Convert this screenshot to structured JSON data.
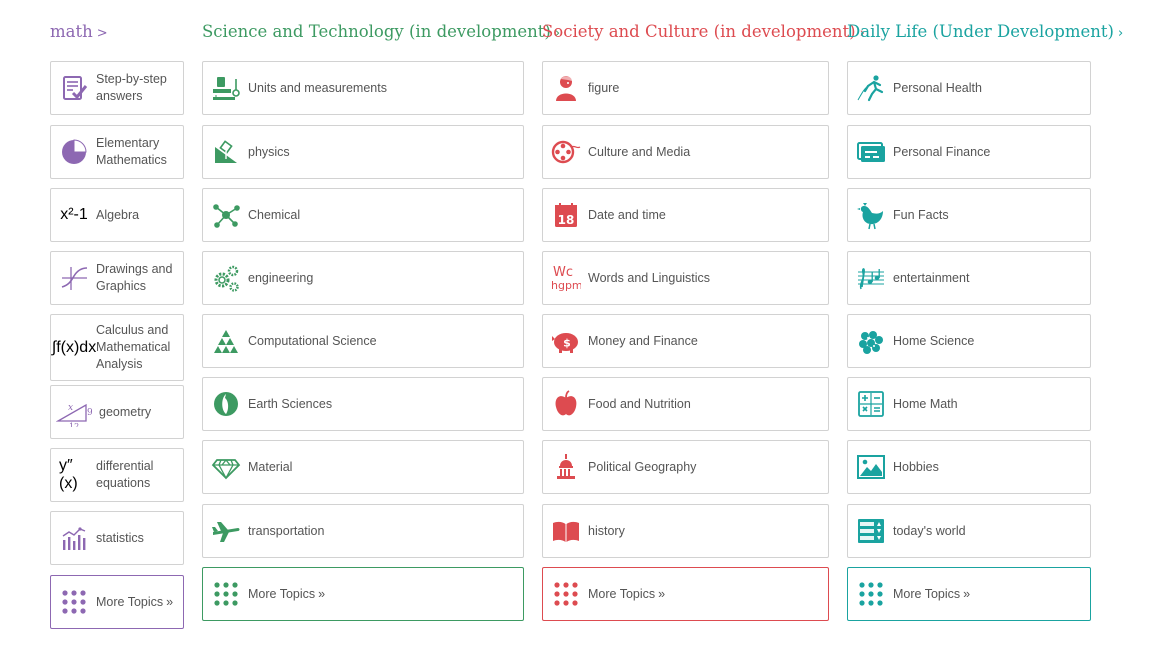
{
  "colors": {
    "math": "#8d68b2",
    "science": "#3d9a62",
    "society": "#dd4b50",
    "life": "#1aa3a0",
    "text": "#555555",
    "border": "#d2d2d2"
  },
  "columns": [
    {
      "key": "math",
      "title": "math",
      "chevron": ">",
      "items": [
        {
          "label": "Step-by-step answers",
          "icon": "checklist-icon"
        },
        {
          "label": "Elementary Mathematics",
          "icon": "fraction-pie-icon"
        },
        {
          "label": "Algebra",
          "icon": "algebra-icon",
          "glyph": "x²-1"
        },
        {
          "label": "Drawings and Graphics",
          "icon": "graph-plot-icon"
        },
        {
          "label": "Calculus and Mathematical Analysis",
          "icon": "integral-icon",
          "glyph": "∫f(x)dx"
        },
        {
          "label": "geometry",
          "icon": "triangle-geometry-icon",
          "glyph_top": "x",
          "glyph_side": "9",
          "glyph_bottom": "12"
        },
        {
          "label": "differential equations",
          "icon": "derivative-icon",
          "glyph": "y″(x)"
        },
        {
          "label": "statistics",
          "icon": "statistics-icon"
        }
      ],
      "more": {
        "label": "More Topics",
        "arrow": "»",
        "icon": "dots-grid-icon"
      }
    },
    {
      "key": "science",
      "title": "Science and Technology (in development)",
      "chevron": "›",
      "items": [
        {
          "label": "Units and measurements",
          "icon": "measurement-icon"
        },
        {
          "label": "physics",
          "icon": "physics-ramp-icon"
        },
        {
          "label": "Chemical",
          "icon": "molecule-icon"
        },
        {
          "label": "engineering",
          "icon": "gears-icon"
        },
        {
          "label": "Computational Science",
          "icon": "sierpinski-icon"
        },
        {
          "label": "Earth Sciences",
          "icon": "globe-icon"
        },
        {
          "label": "Material",
          "icon": "diamond-icon"
        },
        {
          "label": "transportation",
          "icon": "airplane-icon"
        }
      ],
      "more": {
        "label": "More Topics",
        "arrow": "»",
        "icon": "dots-grid-icon"
      }
    },
    {
      "key": "society",
      "title": "Society and Culture (in development)",
      "chevron": "›",
      "items": [
        {
          "label": "figure",
          "icon": "portrait-icon"
        },
        {
          "label": "Culture and Media",
          "icon": "film-reel-icon"
        },
        {
          "label": "Date and time",
          "icon": "calendar-icon",
          "glyph": "18"
        },
        {
          "label": "Words and Linguistics",
          "icon": "letters-icon",
          "glyph_top": "Wc",
          "glyph_bottom": "hgpm"
        },
        {
          "label": "Money and Finance",
          "icon": "piggy-bank-icon",
          "glyph": "$"
        },
        {
          "label": "Food and Nutrition",
          "icon": "apple-icon"
        },
        {
          "label": "Political Geography",
          "icon": "capitol-icon"
        },
        {
          "label": "history",
          "icon": "open-book-icon"
        }
      ],
      "more": {
        "label": "More Topics",
        "arrow": "»",
        "icon": "dots-grid-icon"
      }
    },
    {
      "key": "life",
      "title": "Daily Life (Under Development)",
      "chevron": "›",
      "items": [
        {
          "label": "Personal Health",
          "icon": "runner-icon"
        },
        {
          "label": "Personal Finance",
          "icon": "credit-card-icon"
        },
        {
          "label": "Fun Facts",
          "icon": "chicken-icon"
        },
        {
          "label": "entertainment",
          "icon": "music-staff-icon"
        },
        {
          "label": "Home Science",
          "icon": "grapes-icon"
        },
        {
          "label": "Home Math",
          "icon": "calculator-icon"
        },
        {
          "label": "Hobbies",
          "icon": "picture-icon"
        },
        {
          "label": "today's world",
          "icon": "stock-ticker-icon"
        }
      ],
      "more": {
        "label": "More Topics",
        "arrow": "»",
        "icon": "dots-grid-icon"
      }
    }
  ]
}
